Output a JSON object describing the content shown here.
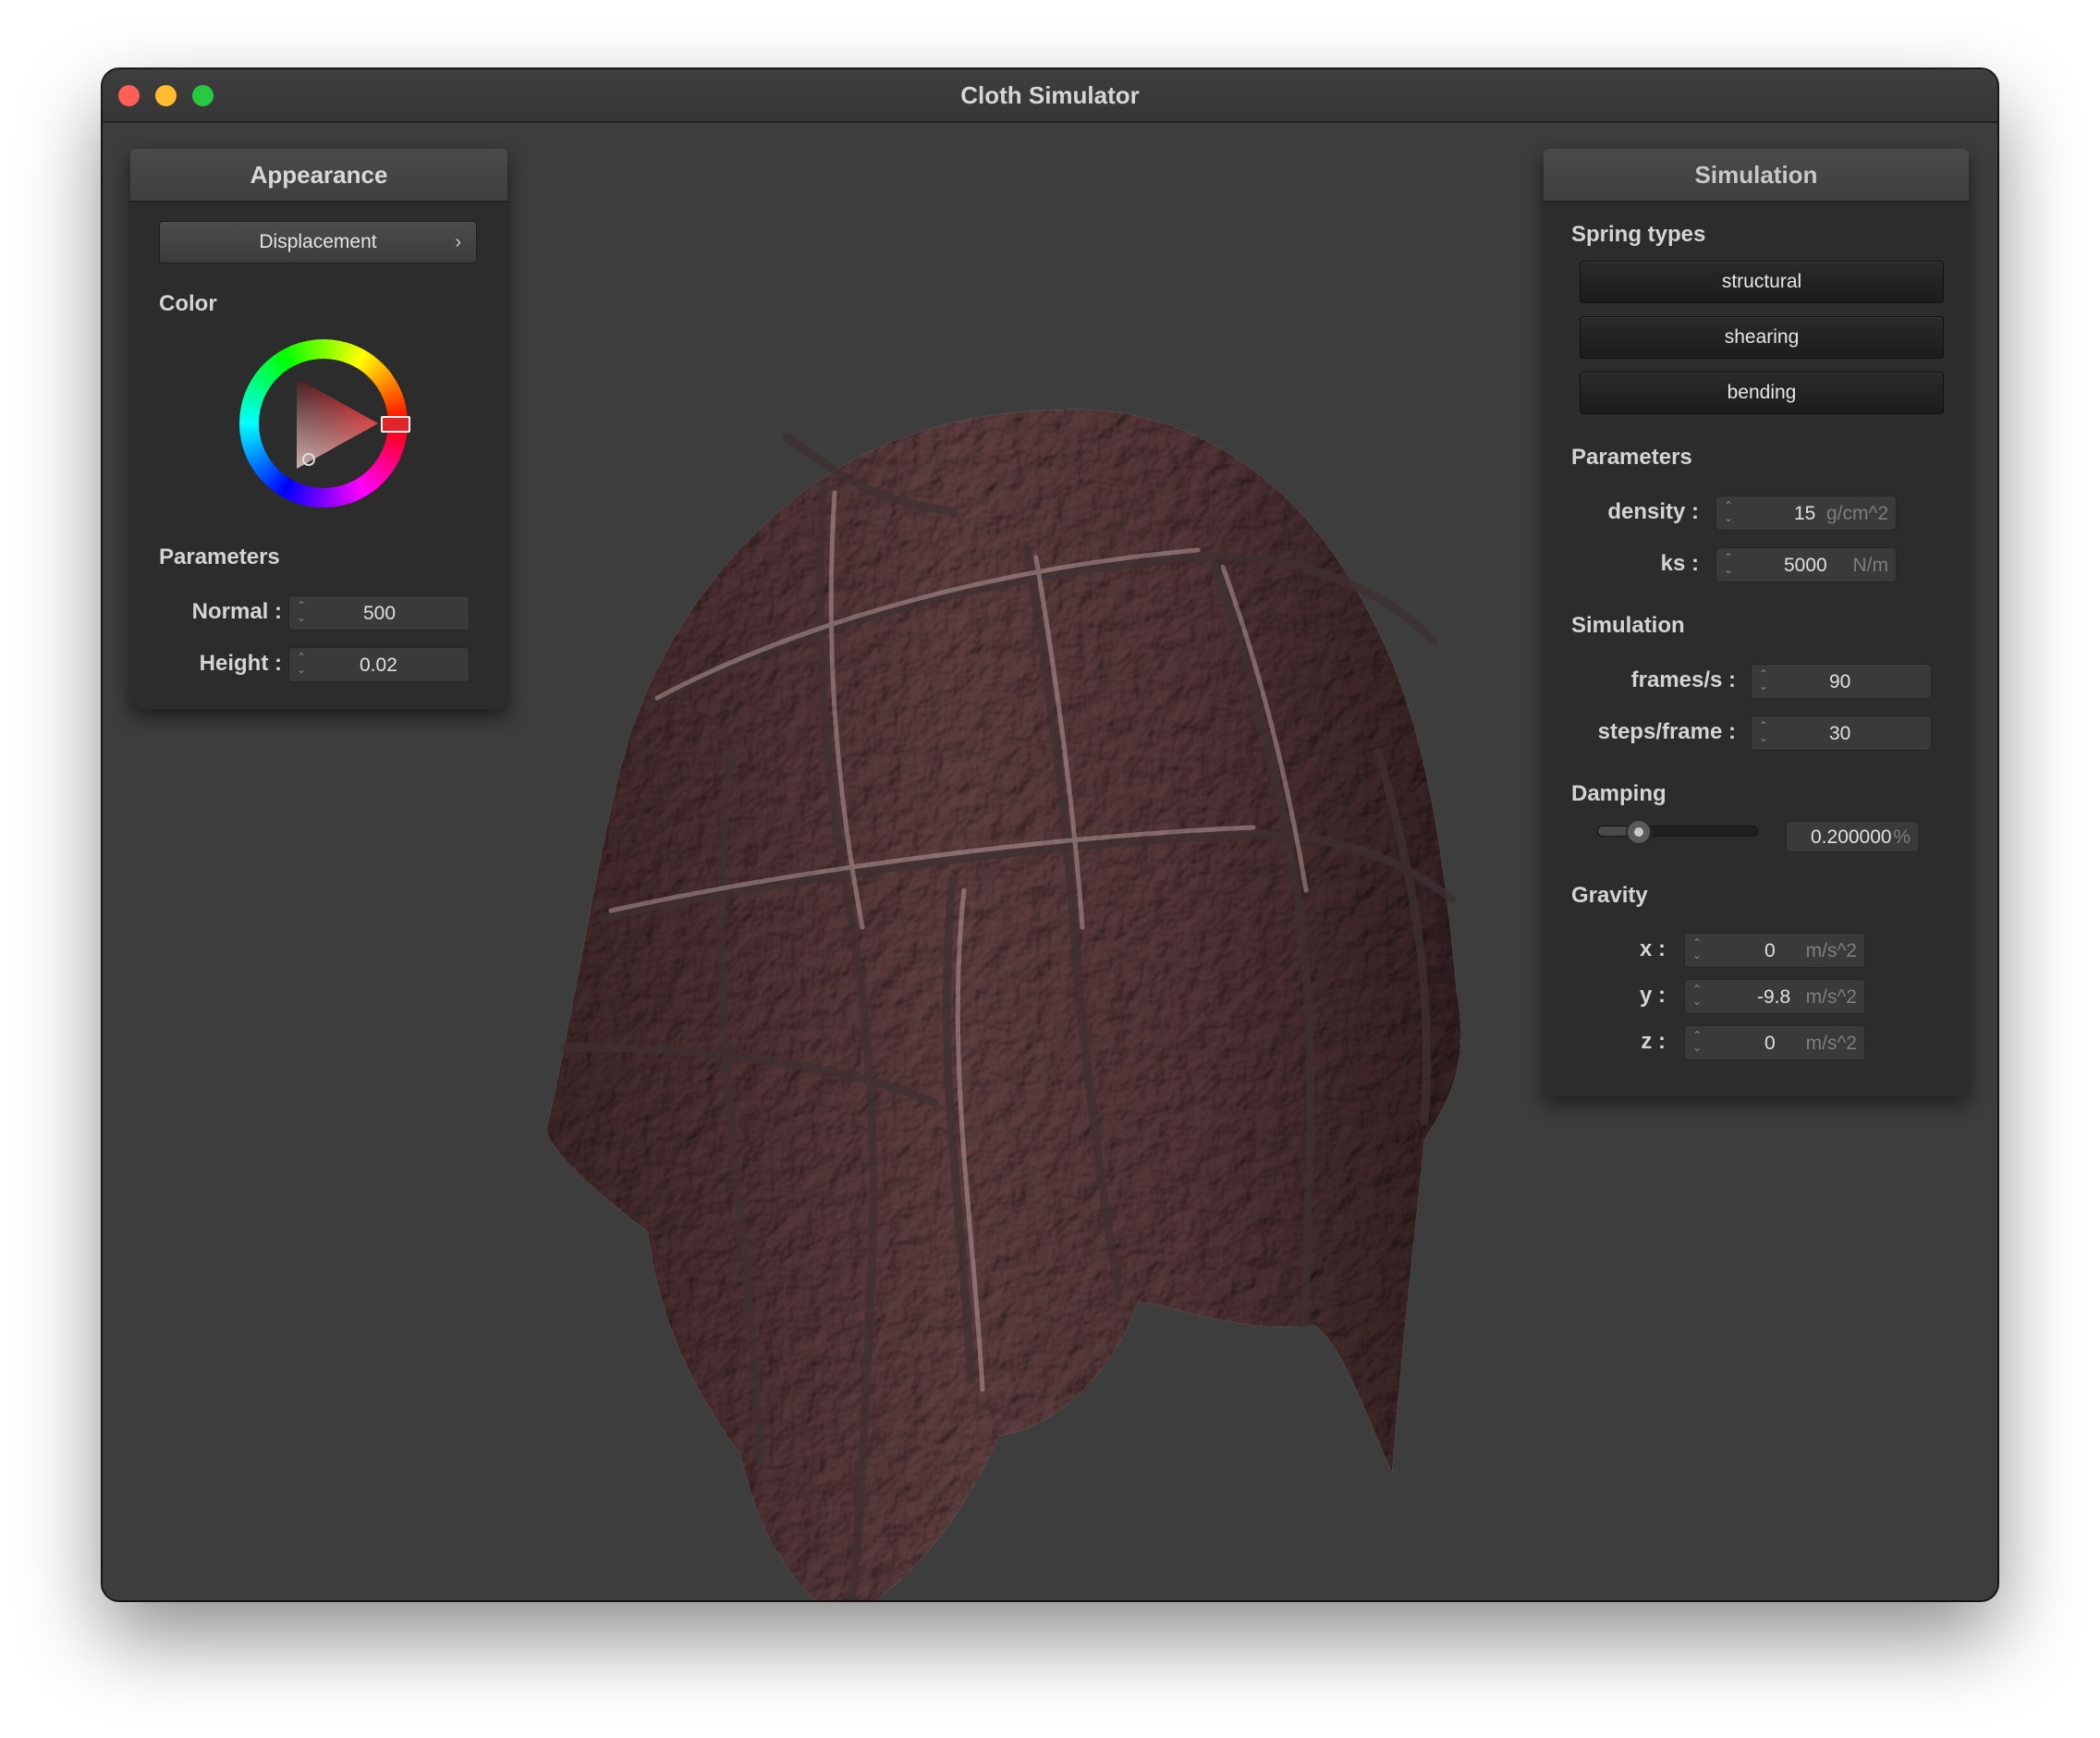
{
  "window": {
    "title": "Cloth Simulator"
  },
  "appearance": {
    "header": "Appearance",
    "mode_button": "Displacement",
    "color_label": "Color",
    "params_label": "Parameters",
    "normal_label": "Normal :",
    "normal_value": "500",
    "height_label": "Height :",
    "height_value": "0.02"
  },
  "simulation": {
    "header": "Simulation",
    "spring_types_label": "Spring types",
    "spring_buttons": [
      "structural",
      "shearing",
      "bending"
    ],
    "params_label": "Parameters",
    "density_label": "density :",
    "density_value": "15",
    "density_unit": "g/cm^2",
    "ks_label": "ks :",
    "ks_value": "5000",
    "ks_unit": "N/m",
    "sim_label": "Simulation",
    "fps_label": "frames/s :",
    "fps_value": "90",
    "steps_label": "steps/frame :",
    "steps_value": "30",
    "damping_label": "Damping",
    "damping_value": "0.200000",
    "damping_unit": "%",
    "damping_level": 0.2,
    "gravity_label": "Gravity",
    "gx_label": "x :",
    "gx_value": "0",
    "gy_label": "y :",
    "gy_value": "-9.8",
    "gz_label": "z :",
    "gz_value": "0",
    "gravity_unit": "m/s^2"
  },
  "colors": {
    "cloth": "#6f5a5c",
    "selected_hue": "#e0262a",
    "background": "#3d3d3d"
  }
}
